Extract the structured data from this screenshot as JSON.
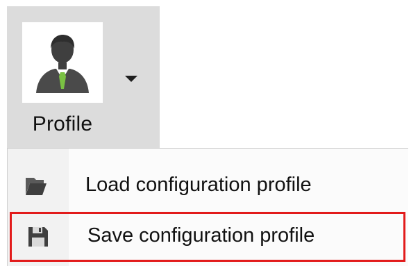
{
  "profile_button": {
    "label": "Profile",
    "icon": "user-profile-icon",
    "tie_color": "#7ac143",
    "has_dropdown": true
  },
  "menu": {
    "items": [
      {
        "label": "Load configuration profile",
        "icon": "folder-open-icon",
        "highlighted": false
      },
      {
        "label": "Save configuration profile",
        "icon": "floppy-disk-icon",
        "highlighted": true
      }
    ],
    "highlight_color": "#e21b1b"
  }
}
